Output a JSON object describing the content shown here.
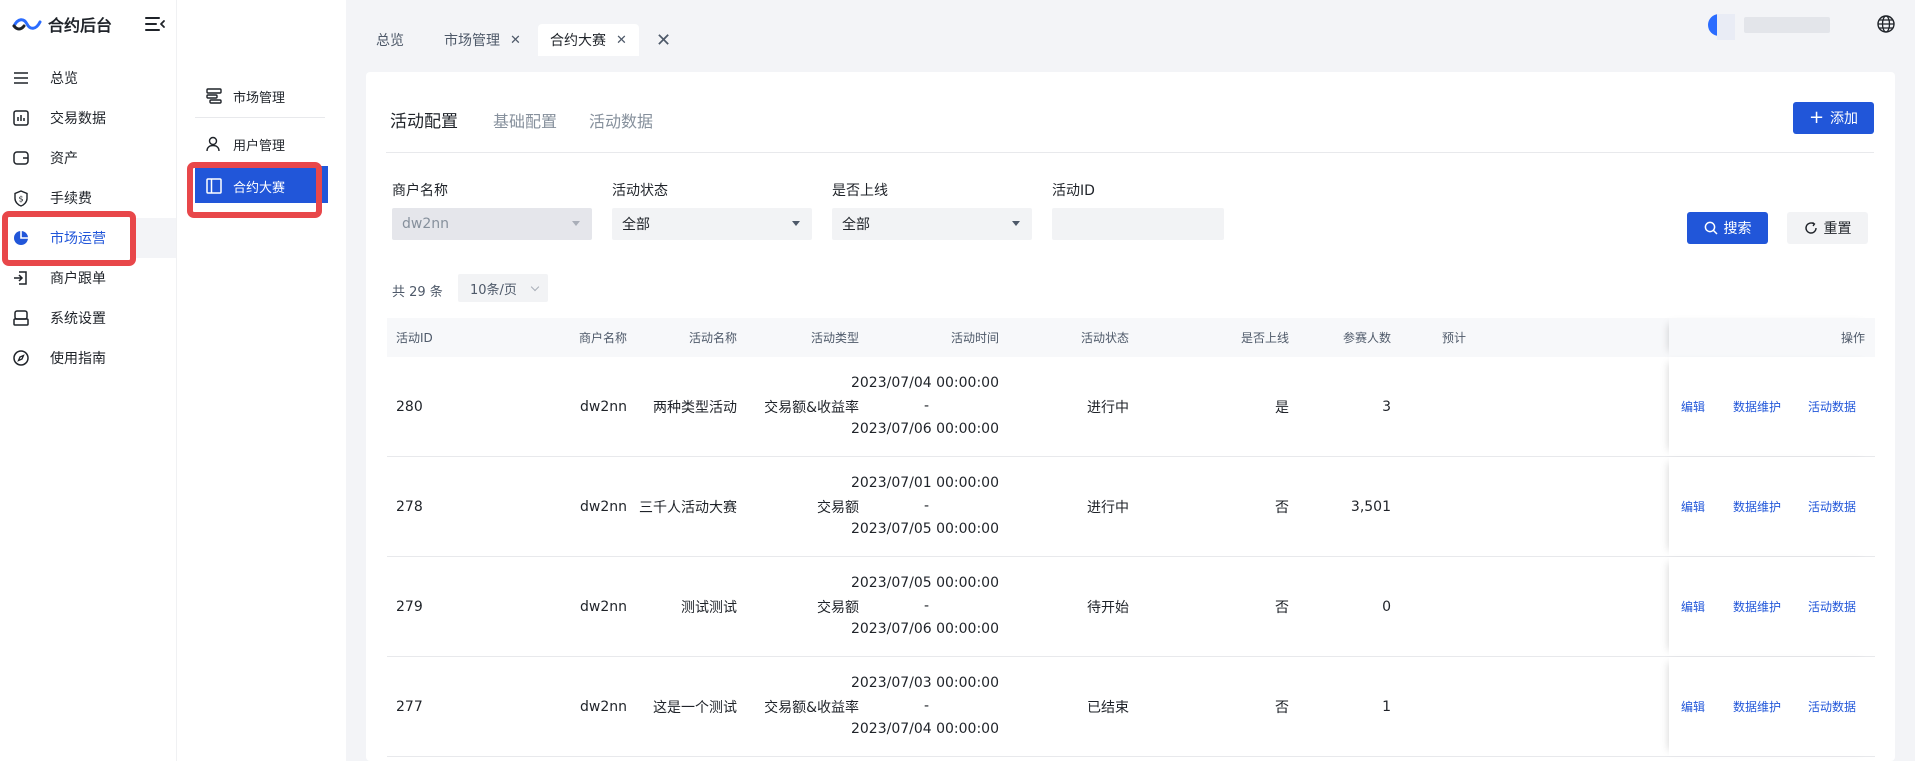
{
  "app": {
    "title": "合约后台"
  },
  "sidebar": {
    "items": [
      {
        "label": "总览",
        "icon": "list-icon"
      },
      {
        "label": "交易数据",
        "icon": "bar-chart-icon"
      },
      {
        "label": "资产",
        "icon": "wallet-icon"
      },
      {
        "label": "手续费",
        "icon": "fee-shield-icon"
      },
      {
        "label": "市场运营",
        "icon": "pie-chart-icon",
        "active": true
      },
      {
        "label": "商户跟单",
        "icon": "follow-icon"
      },
      {
        "label": "系统设置",
        "icon": "settings-box-icon"
      },
      {
        "label": "使用指南",
        "icon": "compass-icon"
      }
    ]
  },
  "submenu": {
    "items": [
      {
        "label": "市场管理",
        "icon": "market-icon"
      },
      {
        "label": "用户管理",
        "icon": "user-icon"
      },
      {
        "label": "合约大赛",
        "icon": "layout-icon",
        "active": true
      }
    ]
  },
  "page_tabs": [
    {
      "label": "总览",
      "closable": false
    },
    {
      "label": "市场管理",
      "closable": true
    },
    {
      "label": "合约大赛",
      "closable": true,
      "active": true
    }
  ],
  "content_tabs": [
    {
      "label": "活动配置",
      "active": true
    },
    {
      "label": "基础配置"
    },
    {
      "label": "活动数据"
    }
  ],
  "actions": {
    "add_label": "添加",
    "search_label": "搜索",
    "reset_label": "重置"
  },
  "filters": {
    "merchant": {
      "label": "商户名称",
      "value": "dw2nn"
    },
    "status": {
      "label": "活动状态",
      "value": "全部"
    },
    "online": {
      "label": "是否上线",
      "value": "全部"
    },
    "activity_id": {
      "label": "活动ID",
      "value": ""
    }
  },
  "pagination": {
    "total_text": "共 29 条",
    "page_size": "10条/页"
  },
  "table": {
    "columns": [
      "活动ID",
      "商户名称",
      "活动名称",
      "活动类型",
      "活动时间",
      "活动状态",
      "是否上线",
      "参赛人数",
      "预计",
      "操作"
    ],
    "op_labels": [
      "编辑",
      "数据维护",
      "活动数据"
    ],
    "rows": [
      {
        "id": "280",
        "merchant": "dw2nn",
        "name": "两种类型活动",
        "type": "交易额&收益率",
        "start": "2023/07/04 00:00:00",
        "sep": "-",
        "end": "2023/07/06 00:00:00",
        "status": "进行中",
        "online": "是",
        "count": "3"
      },
      {
        "id": "278",
        "merchant": "dw2nn",
        "name": "三千人活动大赛",
        "type": "交易额",
        "start": "2023/07/01 00:00:00",
        "sep": "-",
        "end": "2023/07/05 00:00:00",
        "status": "进行中",
        "online": "否",
        "count": "3,501"
      },
      {
        "id": "279",
        "merchant": "dw2nn",
        "name": "测试测试",
        "type": "交易额",
        "start": "2023/07/05 00:00:00",
        "sep": "-",
        "end": "2023/07/06 00:00:00",
        "status": "待开始",
        "online": "否",
        "count": "0"
      },
      {
        "id": "277",
        "merchant": "dw2nn",
        "name": "这是一个测试",
        "type": "交易额&收益率",
        "start": "2023/07/03 00:00:00",
        "sep": "-",
        "end": "2023/07/04 00:00:00",
        "status": "已结束",
        "online": "否",
        "count": "1"
      }
    ]
  },
  "colors": {
    "primary": "#2156d9",
    "highlight": "#e8474a"
  }
}
